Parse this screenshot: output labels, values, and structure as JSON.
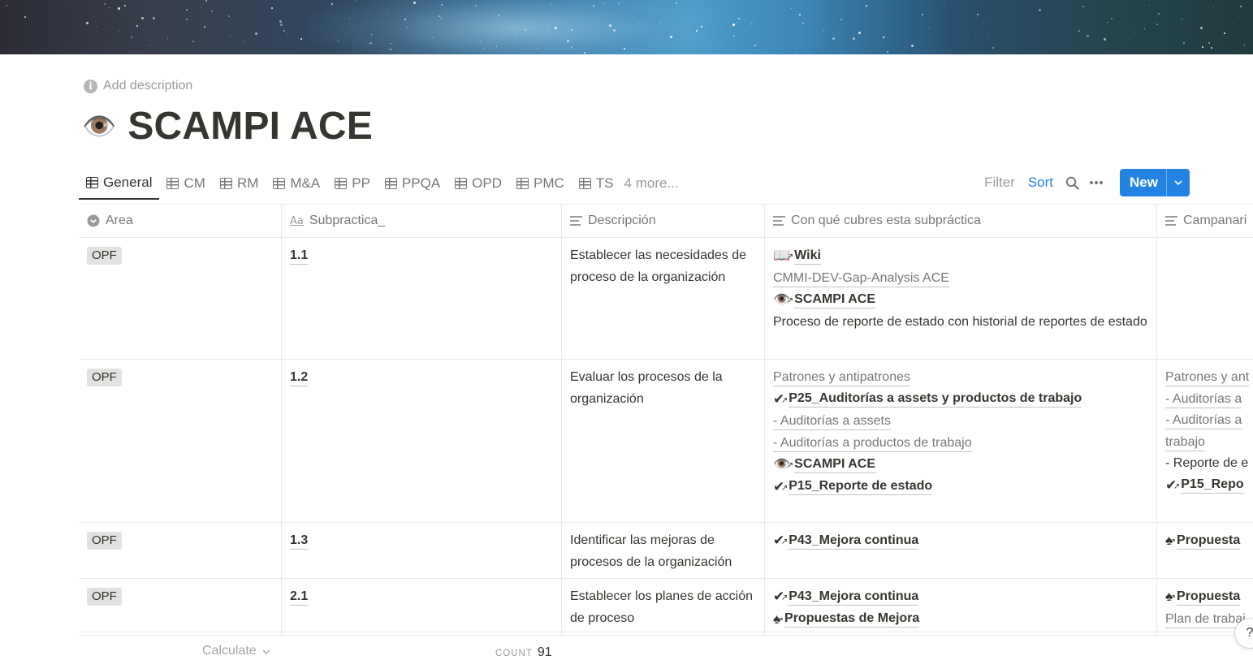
{
  "page": {
    "add_description": "Add description",
    "title_icon": "👁️",
    "title": "SCAMPI ACE"
  },
  "views": {
    "tabs": [
      "General",
      "CM",
      "RM",
      "M&A",
      "PP",
      "PPQA",
      "OPD",
      "PMC",
      "TS"
    ],
    "more": "4 more..."
  },
  "toolbar": {
    "filter": "Filter",
    "sort": "Sort",
    "new": "New"
  },
  "table": {
    "headers": [
      "Area",
      "Subpractica_",
      "Descripción",
      "Con qué cubres esta subpráctica",
      "Campanari"
    ],
    "rows": [
      {
        "area": "OPF",
        "subpractica": "1.1",
        "descripcion": "Establecer las necesidades de proceso de la organización",
        "cubres": [
          {
            "type": "mention",
            "icon": "📖",
            "text": "Wiki"
          },
          {
            "type": "link",
            "text": "CMMI-DEV-Gap-Analysis ACE"
          },
          {
            "type": "mention",
            "icon": "👁️",
            "text": "SCAMPI ACE"
          },
          {
            "type": "text",
            "text": "Proceso de reporte de estado con historial de reportes de estado"
          }
        ],
        "campanario": []
      },
      {
        "area": "OPF",
        "subpractica": "1.2",
        "descripcion": "Evaluar los procesos de la organización",
        "cubres": [
          {
            "type": "link",
            "text": "Patrones y antipatrones"
          },
          {
            "type": "mention",
            "icon": "✔",
            "text": "P25_Auditorías a assets y productos de trabajo"
          },
          {
            "type": "link",
            "text": "- Auditorías a assets"
          },
          {
            "type": "link",
            "text": "- Auditorías a productos de trabajo"
          },
          {
            "type": "mention",
            "icon": "👁️",
            "text": "SCAMPI ACE"
          },
          {
            "type": "mention",
            "icon": "✔",
            "text": "P15_Reporte de estado"
          }
        ],
        "campanario": [
          {
            "type": "link",
            "text": "Patrones y ant"
          },
          {
            "type": "link",
            "text": "- Auditorías a"
          },
          {
            "type": "link",
            "text": "- Auditorías a"
          },
          {
            "type": "link",
            "text": "trabajo"
          },
          {
            "type": "text",
            "text": "- Reporte de e"
          },
          {
            "type": "mention",
            "icon": "✔",
            "text": "P15_Repo"
          }
        ]
      },
      {
        "area": "OPF",
        "subpractica": "1.3",
        "descripcion": "Identificar las mejoras de procesos de la organización",
        "cubres": [
          {
            "type": "mention",
            "icon": "✔",
            "text": "P43_Mejora continua"
          }
        ],
        "campanario": [
          {
            "type": "mention",
            "icon": "♠",
            "text": "Propuesta"
          }
        ]
      },
      {
        "area": "OPF",
        "subpractica": "2.1",
        "descripcion": "Establecer los planes de acción de proceso",
        "cubres": [
          {
            "type": "mention",
            "icon": "✔",
            "text": "P43_Mejora continua"
          },
          {
            "type": "mention",
            "icon": "♠",
            "text": "Propuestas de Mejora"
          }
        ],
        "campanario": [
          {
            "type": "mention",
            "icon": "♠",
            "text": "Propuesta"
          },
          {
            "type": "link",
            "text": "Plan de trabaj"
          }
        ]
      }
    ]
  },
  "footer": {
    "calculate": "Calculate",
    "count_label": "COUNT",
    "count_value": "91"
  },
  "help": "?"
}
